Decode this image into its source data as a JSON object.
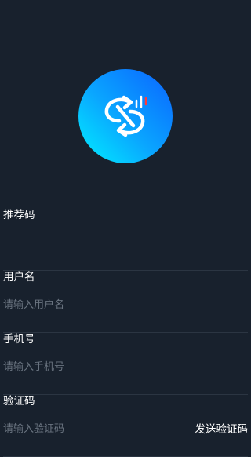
{
  "logo": {
    "icon": "swap-arrows-logo-icon"
  },
  "fields": [
    {
      "label": "推荐码",
      "value": "",
      "placeholder": ""
    },
    {
      "label": "用户名",
      "value": "",
      "placeholder": "请输入用户名"
    },
    {
      "label": "手机号",
      "value": "",
      "placeholder": "请输入手机号"
    },
    {
      "label": "验证码",
      "value": "",
      "placeholder": "请输入验证码"
    }
  ],
  "send_code_label": "发送验证码",
  "colors": {
    "background": "#18212d",
    "divider": "#2b3542",
    "placeholder": "#6a7480",
    "logo_gradient_start": "#00f0ff",
    "logo_gradient_end": "#0b63ff",
    "logo_accent": "#ff3b3b"
  }
}
